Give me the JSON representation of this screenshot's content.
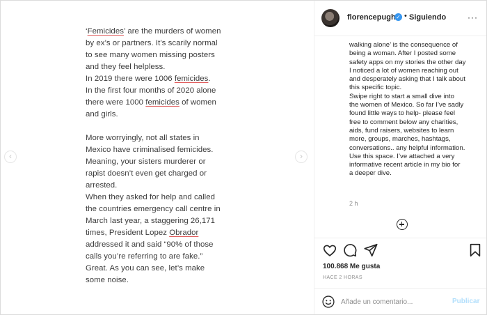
{
  "post_image": {
    "paragraphs": [
      [
        [
          {
            "t": "‘"
          },
          {
            "t": "Femicides",
            "u": true
          },
          {
            "t": "’ are the murders of women"
          }
        ],
        [
          {
            "t": "by ex’s or partners. It’s scarily normal"
          }
        ],
        [
          {
            "t": "to see many women missing posters"
          }
        ],
        [
          {
            "t": "and they feel helpless."
          }
        ],
        [
          {
            "t": "In 2019 there were 1006 "
          },
          {
            "t": "femicides",
            "u": true
          },
          {
            "t": "."
          }
        ],
        [
          {
            "t": "In the first four months of 2020 alone"
          }
        ],
        [
          {
            "t": "there were 1000 "
          },
          {
            "t": "femicides",
            "u": true
          },
          {
            "t": " of women"
          }
        ],
        [
          {
            "t": "and girls."
          }
        ]
      ],
      [
        [
          {
            "t": "More worryingly, not all states in"
          }
        ],
        [
          {
            "t": "Mexico have criminalised femicides."
          }
        ],
        [
          {
            "t": "Meaning, your sisters murderer or"
          }
        ],
        [
          {
            "t": "rapist doesn’t even get charged or"
          }
        ],
        [
          {
            "t": "arrested."
          }
        ],
        [
          {
            "t": "When they asked for help and called"
          }
        ],
        [
          {
            "t": "the countries emergency call centre in"
          }
        ],
        [
          {
            "t": "March last year, a staggering 26,171"
          }
        ],
        [
          {
            "t": "times, President Lopez "
          },
          {
            "t": "Obrador",
            "u": true
          }
        ],
        [
          {
            "t": "addressed it and said “90% of those"
          }
        ],
        [
          {
            "t": "calls you’re referring to are fake.”"
          }
        ],
        [
          {
            "t": "Great. As you can see, let’s make"
          }
        ],
        [
          {
            "t": "some noise."
          }
        ]
      ]
    ],
    "prev_icon": "‹",
    "next_icon": "›"
  },
  "header": {
    "username": "florencepugh",
    "verified_icon": "✓",
    "separator": "•",
    "follow_status": "Siguiendo",
    "more_icon": "···"
  },
  "caption": {
    "lines": [
      "walking alone’ is the consequence of",
      "being a woman. After I posted some",
      "safety apps on my stories the other day",
      "I noticed a lot of women reaching out",
      "and desperately asking that I talk about",
      "this specific topic.",
      "Swipe right to start a small dive into",
      "the women of Mexico. So far I’ve sadly",
      "found little ways to help- please feel",
      "free to comment below any charities,",
      "aids, fund raisers, websites to learn",
      "more, groups, marches, hashtags,",
      "conversations.. any helpful information.",
      "Use this space. I’ve attached a very",
      "informative recent article in my bio for",
      "a deeper dive."
    ],
    "time": "2 h"
  },
  "stats": {
    "likes": "100.868 Me gusta",
    "posted_ago": "HACE 2 HORAS"
  },
  "comment": {
    "placeholder": "Añade un comentario...",
    "publish_label": "Publicar"
  },
  "colors": {
    "accent_blue": "#3897f0",
    "publish_disabled": "#b2dffc",
    "underline_red": "#e05a5a"
  }
}
